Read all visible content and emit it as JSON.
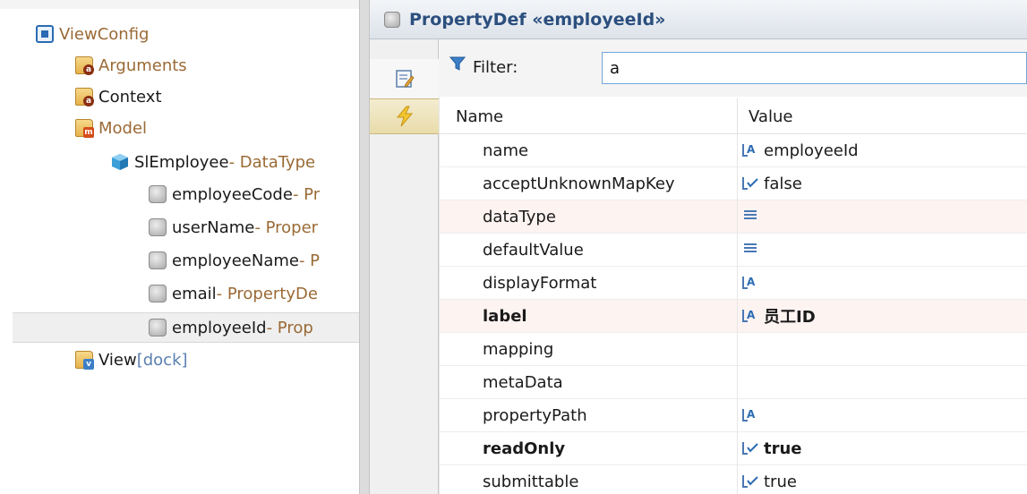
{
  "tree": {
    "nodes": [
      {
        "label": "ViewConfig"
      },
      {
        "label": "Arguments"
      },
      {
        "label": "Context"
      },
      {
        "label": "Model"
      },
      {
        "label": "SlEmployee",
        "suffix": " - DataType"
      },
      {
        "label": "employeeCode",
        "suffix": " - Pr"
      },
      {
        "label": "userName",
        "suffix": " - Proper"
      },
      {
        "label": "employeeName",
        "suffix": " - P"
      },
      {
        "label": "email",
        "suffix": " - PropertyDe"
      },
      {
        "label": "employeeId",
        "suffix": " - Prop"
      },
      {
        "label": "View",
        "suffix": " [dock]"
      }
    ]
  },
  "editor": {
    "title": "PropertyDef «employeeId»"
  },
  "filter": {
    "label": "Filter:",
    "value": "a"
  },
  "grid": {
    "col_name": "Name",
    "col_value": "Value",
    "rows": [
      {
        "name": "name",
        "value": "employeeId"
      },
      {
        "name": "acceptUnknownMapKey",
        "value": "false"
      },
      {
        "name": "dataType",
        "value": ""
      },
      {
        "name": "defaultValue",
        "value": ""
      },
      {
        "name": "displayFormat",
        "value": ""
      },
      {
        "name": "label",
        "value": "员工ID"
      },
      {
        "name": "mapping",
        "value": ""
      },
      {
        "name": "metaData",
        "value": ""
      },
      {
        "name": "propertyPath",
        "value": ""
      },
      {
        "name": "readOnly",
        "value": "true"
      },
      {
        "name": "submittable",
        "value": "true"
      }
    ]
  }
}
